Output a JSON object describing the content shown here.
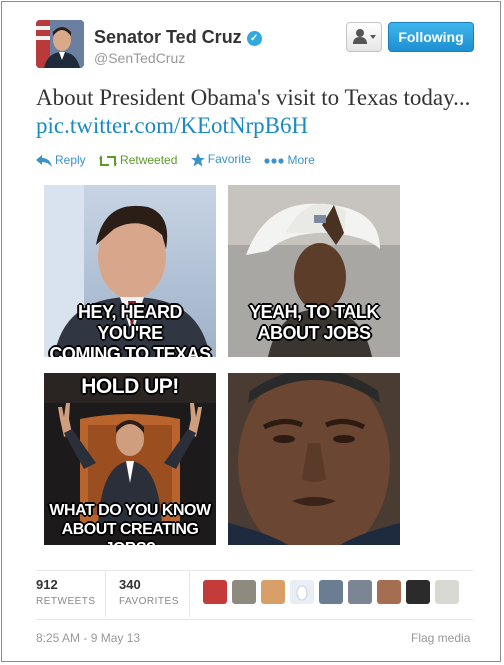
{
  "user": {
    "name": "Senator Ted Cruz",
    "handle": "@SenTedCruz",
    "verified_mark": "✓"
  },
  "buttons": {
    "following": "Following",
    "user_menu_icon": "person-dropdown-icon"
  },
  "tweet": {
    "text_before_link": "About President Obama's visit to Texas today...",
    "link": "pic.twitter.com/KEotNrpB6H"
  },
  "actions": {
    "reply": "Reply",
    "retweeted": "Retweeted",
    "favorite": "Favorite",
    "more": "More"
  },
  "meme": {
    "panel1": [
      "HEY, HEARD YOU'RE",
      "COMING TO TEXAS"
    ],
    "panel2": [
      "YEAH, TO TALK",
      "ABOUT JOBS"
    ],
    "panel3_top": "HOLD UP!",
    "panel3_bottom": [
      "WHAT DO YOU KNOW",
      "ABOUT CREATING JOBS?"
    ]
  },
  "stats": {
    "retweets_count": "912",
    "retweets_label": "RETWEETS",
    "favorites_count": "340",
    "favorites_label": "FAVORITES"
  },
  "footer": {
    "timestamp": "8:25 AM - 9 May 13",
    "flag": "Flag media"
  },
  "colors": {
    "link": "#1a8bbf",
    "follow_button": "#2aa3e3",
    "retweeted_green": "#5c9a2a",
    "action_blue": "#3a92c8"
  }
}
